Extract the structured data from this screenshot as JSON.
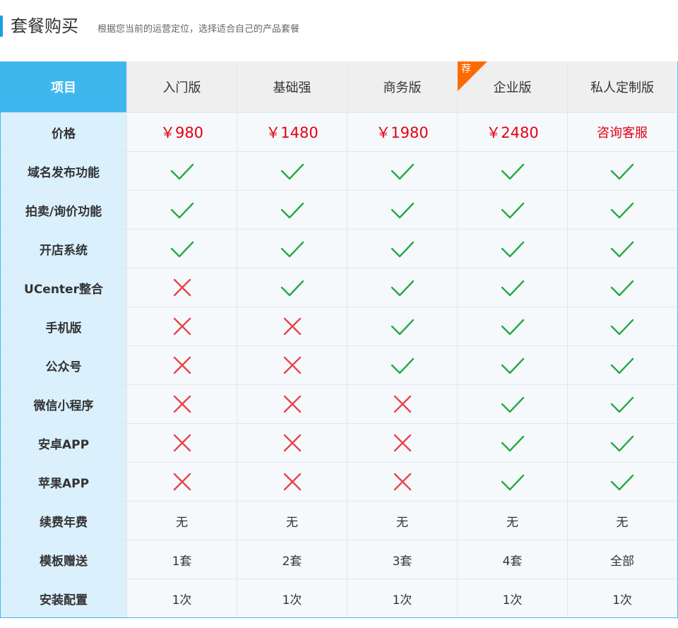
{
  "header": {
    "title": "套餐购买",
    "subtitle": "根据您当前的运营定位，选择适合自己的产品套餐"
  },
  "table": {
    "corner_label": "项目",
    "plans": [
      {
        "name": "入门版",
        "badge": ""
      },
      {
        "name": "基础强",
        "badge": ""
      },
      {
        "name": "商务版",
        "badge": ""
      },
      {
        "name": "企业版",
        "badge": "荐"
      },
      {
        "name": "私人定制版",
        "badge": ""
      }
    ],
    "price_row": {
      "label": "价格",
      "values": [
        "￥980",
        "￥1480",
        "￥1980",
        "￥2480",
        "咨询客服"
      ]
    },
    "feature_rows": [
      {
        "label": "域名发布功能",
        "values": [
          true,
          true,
          true,
          true,
          true
        ]
      },
      {
        "label": "拍卖/询价功能",
        "values": [
          true,
          true,
          true,
          true,
          true
        ]
      },
      {
        "label": "开店系统",
        "values": [
          true,
          true,
          true,
          true,
          true
        ]
      },
      {
        "label": "UCenter整合",
        "values": [
          false,
          true,
          true,
          true,
          true
        ]
      },
      {
        "label": "手机版",
        "values": [
          false,
          false,
          true,
          true,
          true
        ]
      },
      {
        "label": "公众号",
        "values": [
          false,
          false,
          true,
          true,
          true
        ]
      },
      {
        "label": "微信小程序",
        "values": [
          false,
          false,
          false,
          true,
          true
        ]
      },
      {
        "label": "安卓APP",
        "values": [
          false,
          false,
          false,
          true,
          true
        ]
      },
      {
        "label": "苹果APP",
        "values": [
          false,
          false,
          false,
          true,
          true
        ]
      }
    ],
    "text_rows": [
      {
        "label": "续费年费",
        "values": [
          "无",
          "无",
          "无",
          "无",
          "无"
        ]
      },
      {
        "label": "模板赠送",
        "values": [
          "1套",
          "2套",
          "3套",
          "4套",
          "全部"
        ]
      },
      {
        "label": "安装配置",
        "values": [
          "1次",
          "1次",
          "1次",
          "1次",
          "1次"
        ]
      }
    ]
  },
  "colors": {
    "accent": "#3fb7ee",
    "price": "#e60012",
    "check": "#27a844",
    "cross": "#e8454b",
    "badge": "#ff6a00"
  },
  "icons": {
    "yes": "check-icon",
    "no": "cross-icon"
  }
}
